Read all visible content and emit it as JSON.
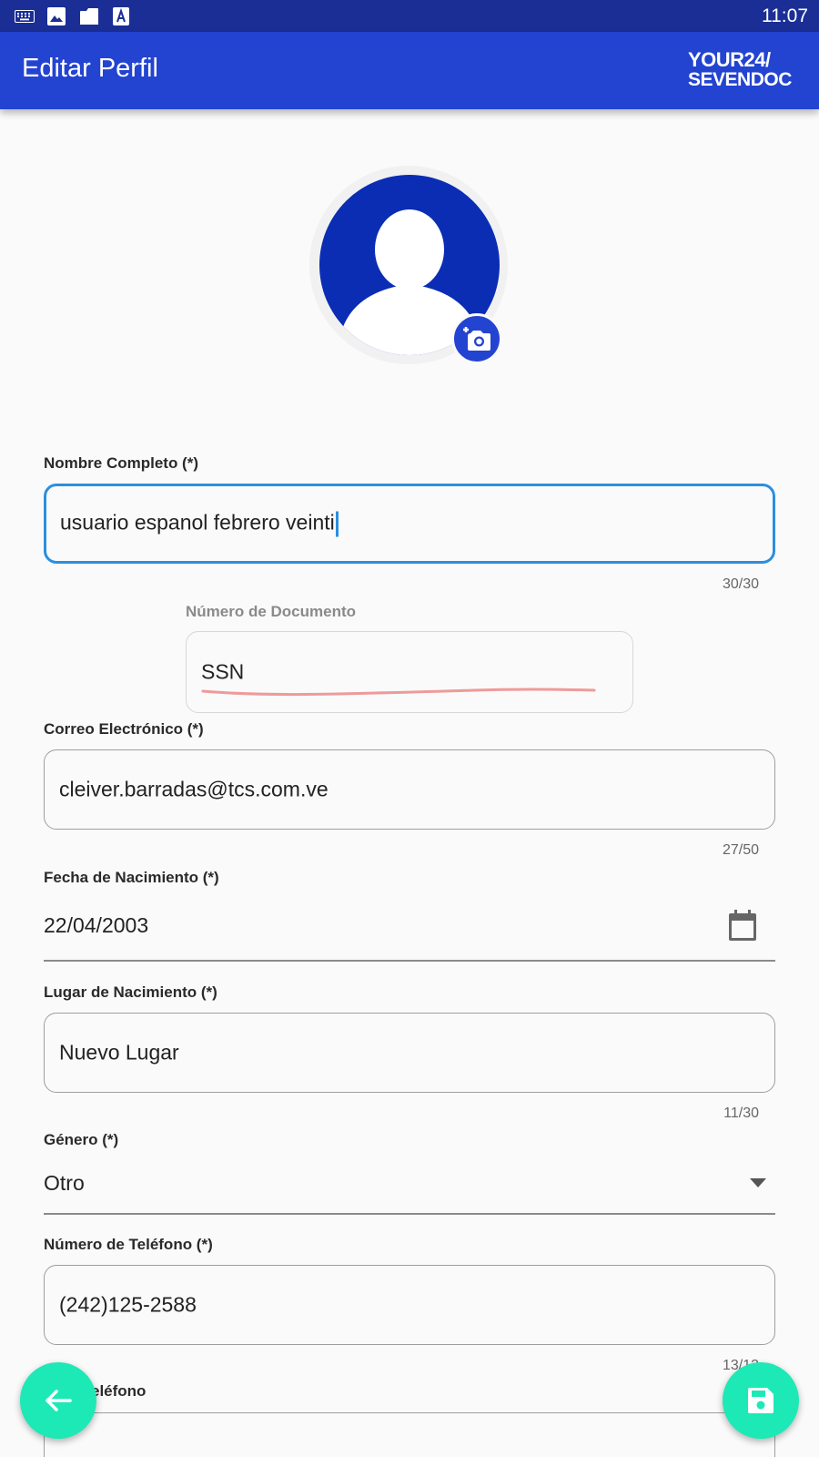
{
  "status_bar": {
    "time": "11:07",
    "icons": [
      "keyboard-icon",
      "image-icon",
      "sd-card-icon",
      "font-a-icon"
    ]
  },
  "app_bar": {
    "title": "Editar Perfil",
    "logo_line1": "YOUR24/",
    "logo_line2": "SEVENDOC"
  },
  "avatar": {
    "add_photo_icon": "add-photo-camera-icon"
  },
  "form": {
    "nombre": {
      "label": "Nombre Completo (*)",
      "value": "usuario espanol febrero veinti",
      "counter": "30/30"
    },
    "documento": {
      "label": "Número de Documento",
      "value": "SSN"
    },
    "correo": {
      "label": "Correo Electrónico (*)",
      "value": "cleiver.barradas@tcs.com.ve",
      "counter": "27/50"
    },
    "fecha": {
      "label": "Fecha de Nacimiento (*)",
      "value": "22/04/2003",
      "icon": "calendar-icon"
    },
    "lugar": {
      "label": "Lugar de Nacimiento (*)",
      "value": "Nuevo Lugar",
      "counter": "11/30"
    },
    "genero": {
      "label": "Género (*)",
      "value": "Otro",
      "icon": "dropdown-arrow-icon"
    },
    "telefono": {
      "label": "Número de Teléfono (*)",
      "value": "(242)125-2588",
      "counter": "13/13"
    },
    "telefono2": {
      "label_partial": "eléfono"
    }
  },
  "fabs": {
    "back_icon": "arrow-back-icon",
    "save_icon": "save-icon"
  },
  "colors": {
    "status_bar": "#1a2e96",
    "app_bar": "#2343d1",
    "avatar_bg": "#0a2db4",
    "focus": "#2a8fe0",
    "fab": "#1de9b6"
  }
}
